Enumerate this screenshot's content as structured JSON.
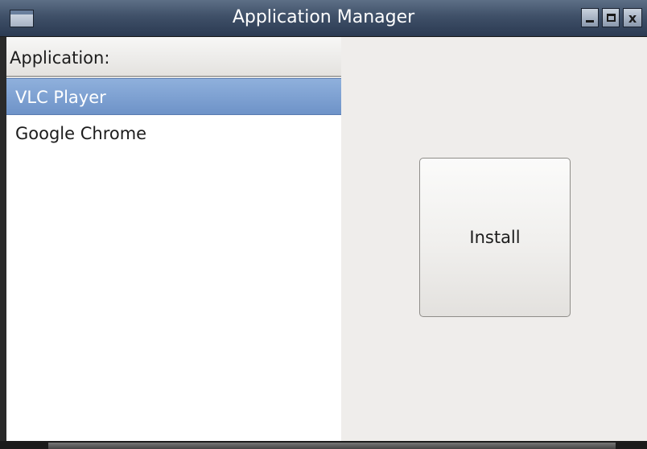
{
  "window": {
    "title": "Application Manager",
    "minimize_label": "",
    "maximize_label": "",
    "close_label": "x"
  },
  "list": {
    "header": "Application:",
    "items": [
      {
        "label": "VLC Player",
        "selected": true
      },
      {
        "label": "Google Chrome",
        "selected": false
      }
    ]
  },
  "actions": {
    "install_label": "Install"
  },
  "colors": {
    "titlebar": "#3f5068",
    "selection": "#7a9dd0",
    "panel_bg": "#efedeb",
    "list_bg": "#ffffff"
  }
}
